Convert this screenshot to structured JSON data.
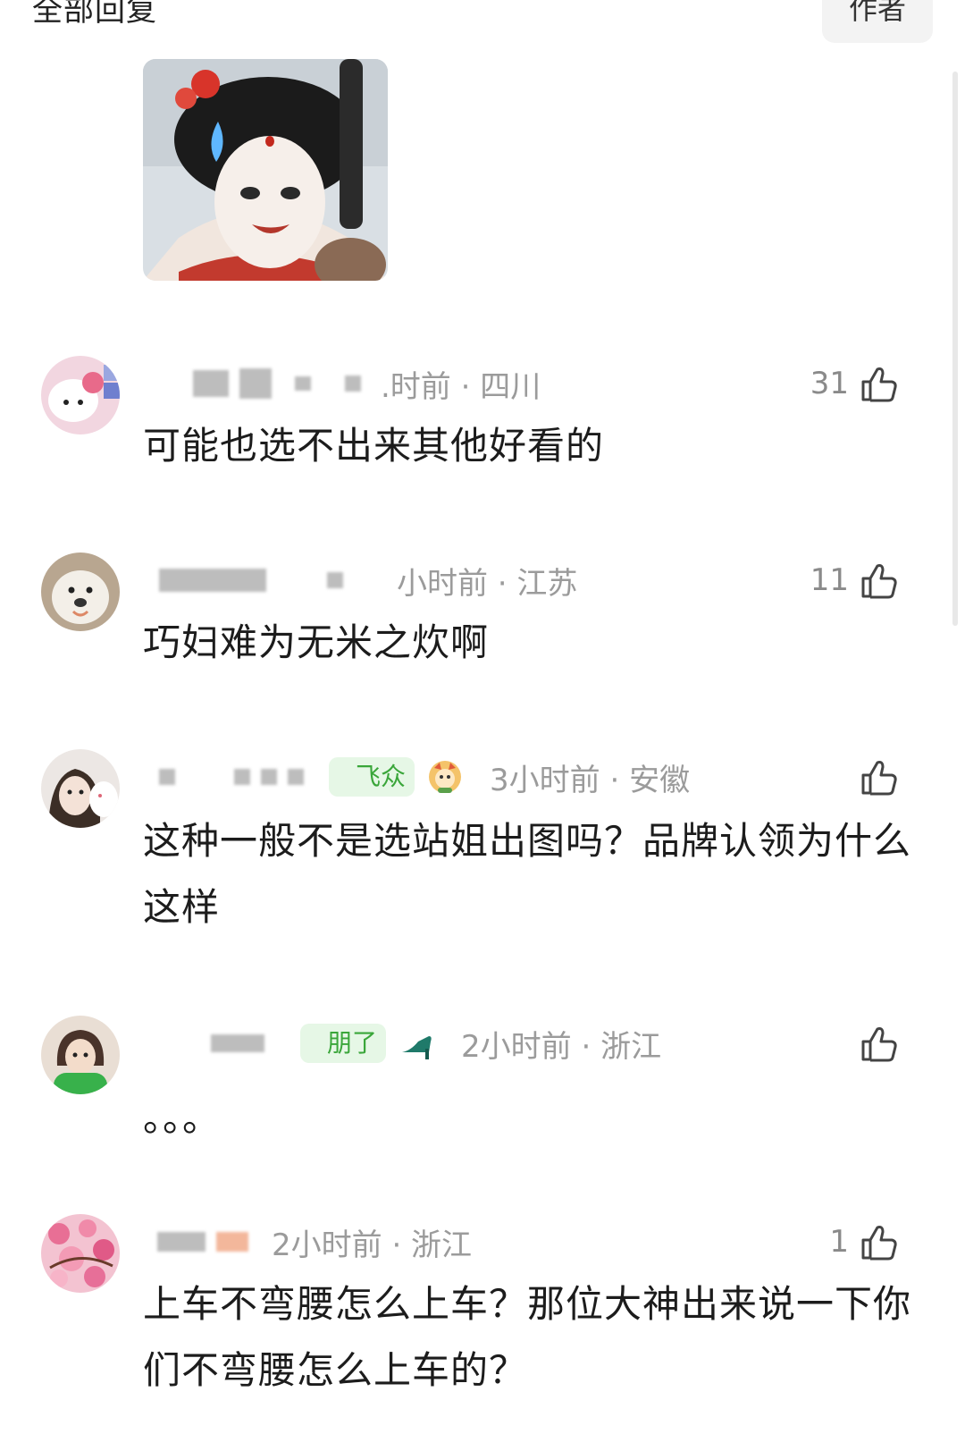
{
  "header": {
    "title": "全部回复",
    "author_button": "作者"
  },
  "comments": [
    {
      "meta": ".时前 · 四川",
      "likes": "31",
      "text": "可能也选不出来其他好看的"
    },
    {
      "meta": "小时前 · 江苏",
      "likes": "11",
      "text": "巧妇难为无米之炊啊"
    },
    {
      "badge": "飞众",
      "meta": "3小时前 · 安徽",
      "likes": "",
      "text": "这种一般不是选站姐出图吗？品牌认领为什么这样"
    },
    {
      "badge": "朋了",
      "meta": "2小时前 · 浙江",
      "likes": "",
      "text": "。。。"
    },
    {
      "meta": "2小时前 · 浙江",
      "likes": "1",
      "text": "上车不弯腰怎么上车？那位大神出来说一下你们不弯腰怎么上车的？"
    }
  ],
  "icons": {
    "like": "thumbs-up-icon",
    "reply_sticker": "sticker-image"
  },
  "colors": {
    "meta_gray": "#9b9b9b",
    "badge_green": "#3aa63a",
    "badge_bg": "#e6f7e6"
  }
}
